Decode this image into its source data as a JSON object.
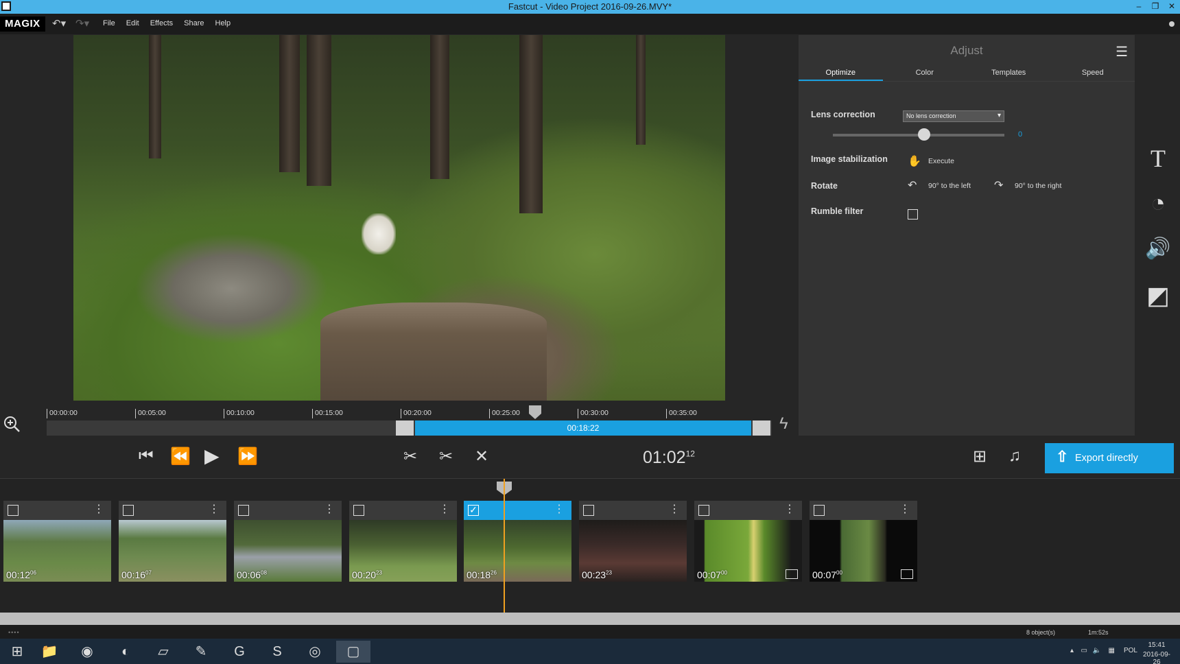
{
  "window": {
    "title": "Fastcut - Video Project 2016-09-26.MVY*",
    "controls": [
      "–",
      "❐",
      "✕"
    ]
  },
  "menubar": {
    "logo": "MAGIX",
    "items": [
      "File",
      "Edit",
      "Effects",
      "Share",
      "Help"
    ]
  },
  "ruler": {
    "ticks": [
      "00:00:00",
      "00:05:00",
      "00:10:00",
      "00:15:00",
      "00:20:00",
      "00:25:00",
      "00:30:00",
      "00:35:00"
    ]
  },
  "trim": {
    "selection_duration": "00:18:22"
  },
  "transport": {
    "timecode_main": "01:02",
    "timecode_frames": "12",
    "export_label": "Export directly"
  },
  "panel": {
    "title": "Adjust",
    "tabs": [
      "Optimize",
      "Color",
      "Templates",
      "Speed"
    ],
    "active_tab": "Optimize",
    "lens_correction": {
      "label": "Lens correction",
      "value": "No lens correction",
      "slider_value": "0"
    },
    "image_stabilization": {
      "label": "Image stabilization",
      "action": "Execute"
    },
    "rotate": {
      "label": "Rotate",
      "left": "90° to the left",
      "right": "90° to the right"
    },
    "rumble_filter": {
      "label": "Rumble filter",
      "checked": false
    }
  },
  "clips": [
    {
      "duration": "00:12",
      "frames": "06",
      "checked": false,
      "selected": false,
      "type": "video"
    },
    {
      "duration": "00:16",
      "frames": "07",
      "checked": false,
      "selected": false,
      "type": "video"
    },
    {
      "duration": "00:06",
      "frames": "08",
      "checked": false,
      "selected": false,
      "type": "video"
    },
    {
      "duration": "00:20",
      "frames": "23",
      "checked": false,
      "selected": false,
      "type": "video"
    },
    {
      "duration": "00:18",
      "frames": "26",
      "checked": true,
      "selected": true,
      "type": "video"
    },
    {
      "duration": "00:23",
      "frames": "23",
      "checked": false,
      "selected": false,
      "type": "video"
    },
    {
      "duration": "00:07",
      "frames": "00",
      "checked": false,
      "selected": false,
      "type": "image"
    },
    {
      "duration": "00:07",
      "frames": "00",
      "checked": false,
      "selected": false,
      "type": "image"
    }
  ],
  "status": {
    "objects": "8 object(s)",
    "total": "1m:52s"
  },
  "taskbar": {
    "tray": {
      "language": "POL",
      "time": "15:41",
      "date": "2016-09-26"
    }
  },
  "colors": {
    "accent": "#1aa0e0",
    "titlebar": "#4ab3e8",
    "playhead": "#f0a020"
  }
}
